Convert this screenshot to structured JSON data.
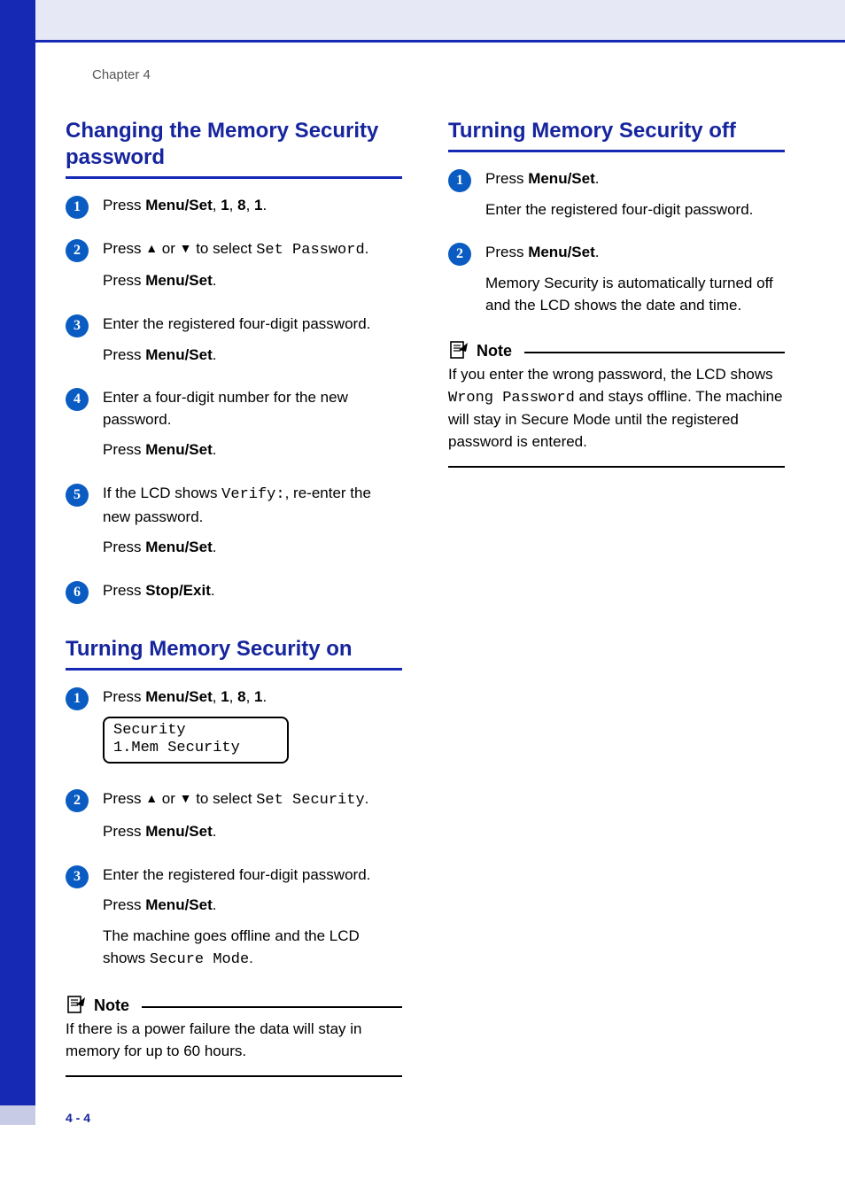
{
  "chapter": "Chapter 4",
  "footer": "4 - 4",
  "left": {
    "s1": {
      "title": "Changing the Memory Security password",
      "step1_a": "Press ",
      "step1_b": "Menu/Set",
      "step1_c": ", ",
      "step1_d": "1",
      "step1_e": ", ",
      "step1_f": "8",
      "step1_g": ", ",
      "step1_h": "1",
      "step1_i": ".",
      "step2_a": "Press ",
      "step2_b": " or ",
      "step2_c": " to select ",
      "step2_mono": "Set Password",
      "step2_d": ".",
      "step2_line2a": "Press ",
      "step2_line2b": "Menu/Set",
      "step2_line2c": ".",
      "step3_a": "Enter the registered four-digit password.",
      "step3_b1": "Press ",
      "step3_b2": "Menu/Set",
      "step3_b3": ".",
      "step4_a": "Enter a four-digit number for the new password.",
      "step4_b1": "Press ",
      "step4_b2": "Menu/Set",
      "step4_b3": ".",
      "step5_a": "If the LCD shows ",
      "step5_mono": "Verify:",
      "step5_b": ", re-enter the new password.",
      "step5_c1": "Press ",
      "step5_c2": "Menu/Set",
      "step5_c3": ".",
      "step6_a": "Press ",
      "step6_b": "Stop/Exit",
      "step6_c": "."
    },
    "s2": {
      "title": "Turning Memory Security on",
      "step1_a": "Press ",
      "step1_b": "Menu/Set",
      "step1_c": ", ",
      "step1_d": "1",
      "step1_e": ", ",
      "step1_f": "8",
      "step1_g": ", ",
      "step1_h": "1",
      "step1_i": ".",
      "lcd": "Security\n1.Mem Security",
      "step2_a": "Press ",
      "step2_b": " or ",
      "step2_c": " to select ",
      "step2_mono": "Set Security",
      "step2_d": ".",
      "step2_line2a": "Press ",
      "step2_line2b": "Menu/Set",
      "step2_line2c": ".",
      "step3_a": "Enter the registered four-digit password.",
      "step3_b1": "Press ",
      "step3_b2": "Menu/Set",
      "step3_b3": ".",
      "step3_c1": "The machine goes offline and the LCD shows ",
      "step3_mono": "Secure Mode",
      "step3_c2": ".",
      "note_label": "Note",
      "note_body": "If there is a power failure the data will stay in memory for up to 60 hours."
    }
  },
  "right": {
    "s1": {
      "title": "Turning Memory Security off",
      "step1_a": "Press ",
      "step1_b": "Menu/Set",
      "step1_c": ".",
      "step1_d": "Enter the registered four-digit password.",
      "step2_a": "Press ",
      "step2_b": "Menu/Set",
      "step2_c": ".",
      "step2_d": "Memory Security is automatically turned off and the LCD shows the date and time.",
      "note_label": "Note",
      "note_a": "If you enter the wrong password, the LCD shows ",
      "note_mono": "Wrong Password",
      "note_b": " and stays offline. The machine will stay in Secure Mode until the registered password is entered."
    }
  },
  "badges": {
    "n1": "1",
    "n2": "2",
    "n3": "3",
    "n4": "4",
    "n5": "5",
    "n6": "6"
  },
  "arrows": {
    "up": "▲",
    "down": "▼"
  }
}
